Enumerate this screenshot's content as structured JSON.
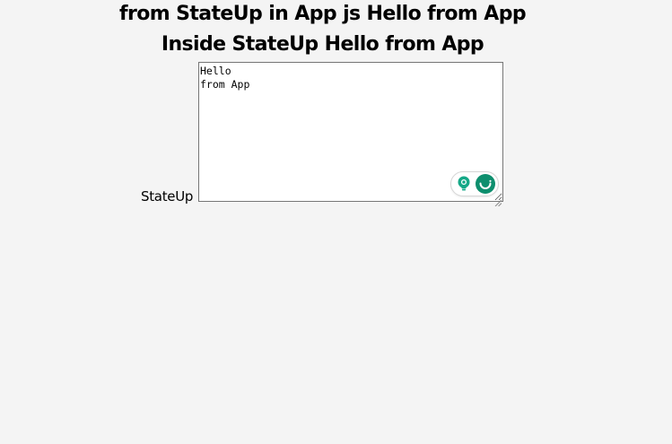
{
  "headings": {
    "line1": "from StateUp in App js Hello from App",
    "line2": "Inside StateUp Hello from App"
  },
  "field": {
    "label": "StateUp",
    "value": "Hello\nfrom App"
  },
  "assistant": {
    "icons": [
      "lightbulb-icon",
      "assistant-logo-icon"
    ],
    "accent_color": "#15a887",
    "logo_color": "#0e8f6e"
  }
}
